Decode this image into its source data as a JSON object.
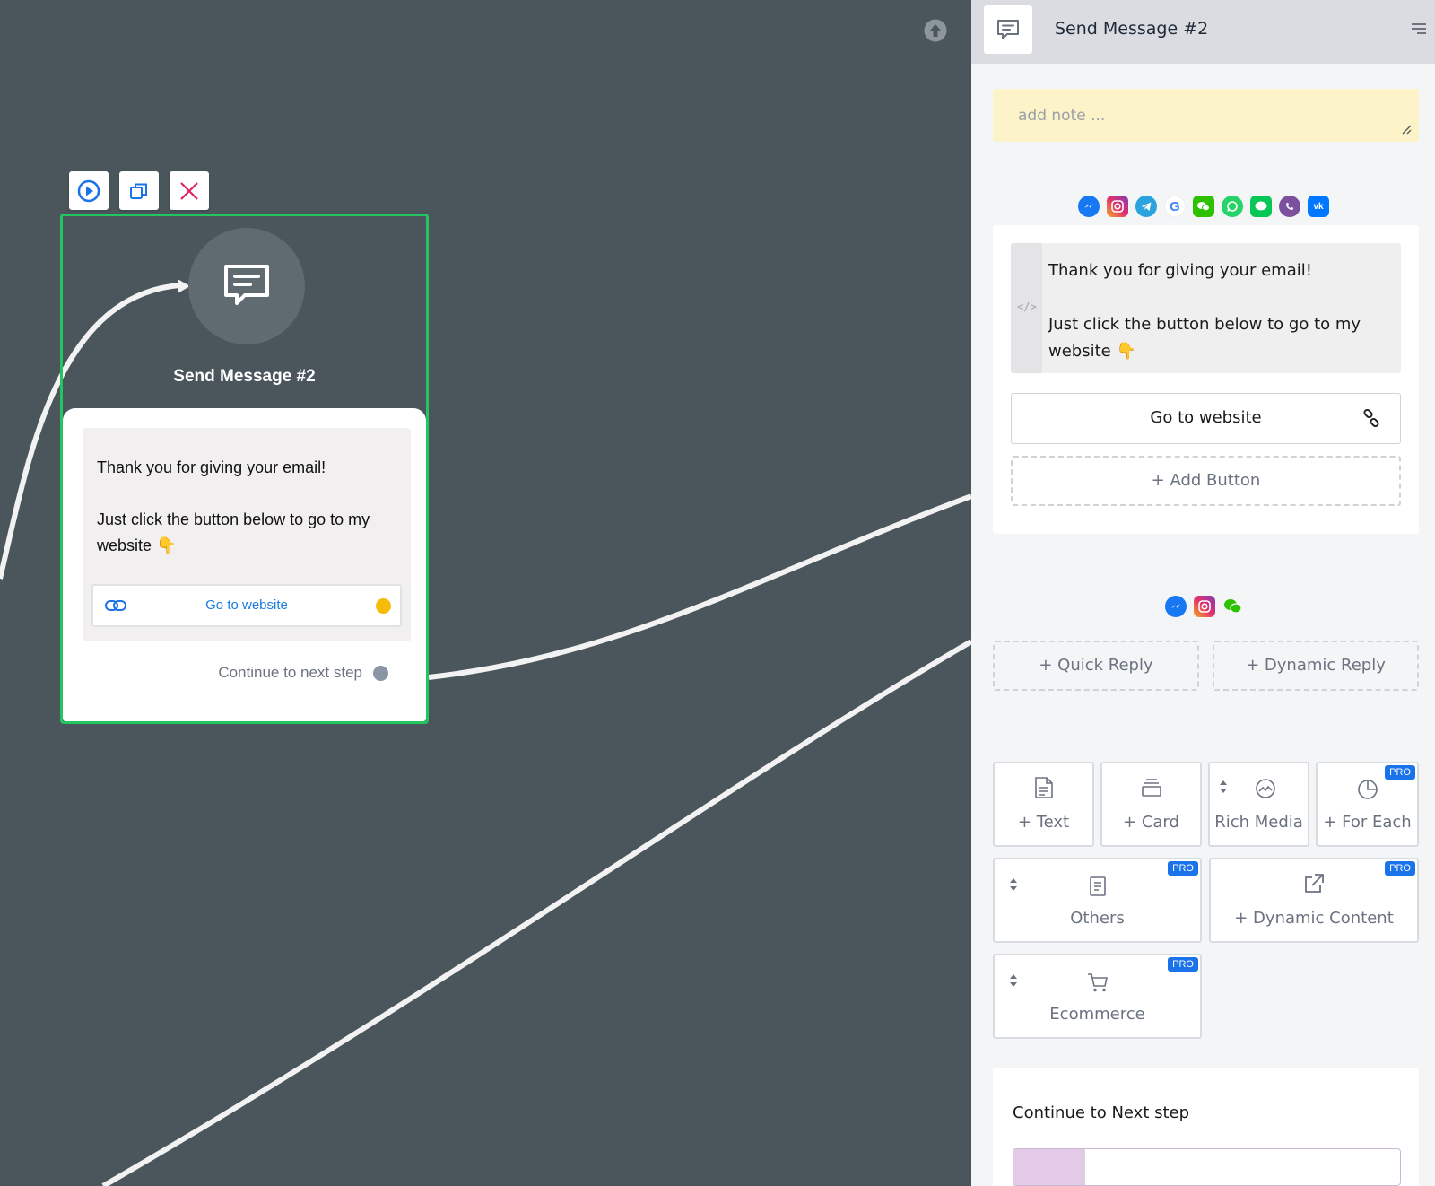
{
  "node": {
    "title": "Send Message #2",
    "message": "Thank you for giving your email!\n\nJust click the button below to go to my website 👇",
    "button_label": "Go to website",
    "continue_label": "Continue to next step"
  },
  "panel": {
    "title": "Send Message #2",
    "note_placeholder": "add note ...",
    "message": "Thank you for giving your email!\n\nJust click the button below to go to my website 👇",
    "button_label": "Go to website",
    "add_button_label": "+ Add Button",
    "quick_reply_label": "+ Quick Reply",
    "dynamic_reply_label": "+ Dynamic Reply",
    "tiles": {
      "text": "+ Text",
      "card": "+ Card",
      "rich_media": "Rich Media",
      "for_each": "+ For Each",
      "others": "Others",
      "dynamic_content": "+ Dynamic Content",
      "ecommerce": "Ecommerce"
    },
    "pro_badge": "PRO",
    "continue_title": "Continue to Next step"
  },
  "platforms_top": [
    "messenger-icon",
    "instagram-icon",
    "telegram-icon",
    "google-icon",
    "wechat-icon",
    "whatsapp-icon",
    "line-icon",
    "viber-icon",
    "vk-icon"
  ],
  "platforms_reply": [
    "messenger-icon",
    "instagram-icon",
    "wechat-icon"
  ],
  "colors": {
    "canvas": "#4a555c",
    "selection": "#22c55e",
    "link_blue": "#1a7be0",
    "button_dot": "#f5bd0a",
    "pro_badge": "#1a73e8",
    "note_bg": "#fdf3c9"
  }
}
